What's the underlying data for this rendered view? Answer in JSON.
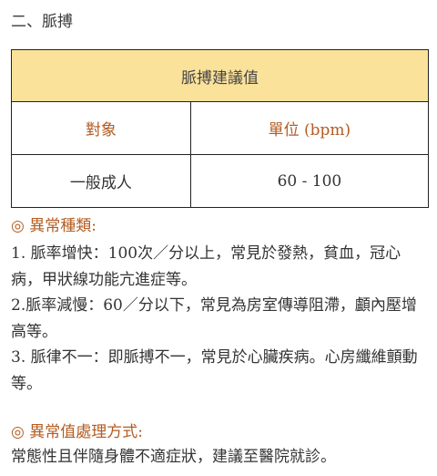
{
  "heading": "二、脈搏",
  "table": {
    "title": "脈搏建議值",
    "col1_header": "對象",
    "col2_header": "單位 (bpm)",
    "row_subject": "一般成人",
    "row_value": "60 - 100"
  },
  "abnormal_types": {
    "title": "◎ 異常種類:",
    "items": [
      "1. 脈率增快：100次／分以上，常見於發熱，貧血，冠心病，甲狀線功能亢進症等。",
      "2.脈率減慢：60／分以下，常見為房室傳導阻滯，顱內壓增高等。",
      "3. 脈律不一：即脈搏不一，常見於心臟疾病。心房纖維顫動等。"
    ]
  },
  "handling": {
    "title": "◎ 異常值處理方式:",
    "text": "常態性且伴隨身體不適症狀，建議至醫院就診。"
  }
}
